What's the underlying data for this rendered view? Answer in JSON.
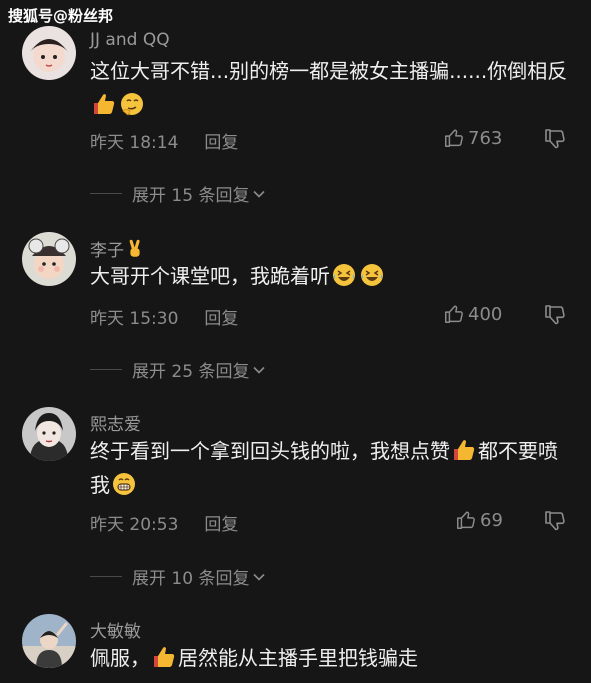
{
  "watermark": "搜狐号@粉丝邦",
  "comments": [
    {
      "username": "JJ  and  QQ",
      "text_parts": [
        "这位大哥不错...别的榜一都是被女主播骗......你倒相反"
      ],
      "emojis": [
        "thumbs-up-emoji",
        "thinking-face-emoji"
      ],
      "time": "昨天 18:14",
      "reply": "回复",
      "likes": "763",
      "expand": "展开 15 条回复"
    },
    {
      "username": "李子",
      "username_emoji": "victory-hand-emoji",
      "text_parts": [
        "大哥开个课堂吧，我跪着听"
      ],
      "emojis": [
        "rolling-laughing-emoji",
        "rolling-laughing-emoji"
      ],
      "time": "昨天 15:30",
      "reply": "回复",
      "likes": "400",
      "expand": "展开 25 条回复"
    },
    {
      "username": "熙志爱",
      "text_parts": [
        "终于看到一个拿到回头钱的啦，我想点赞",
        "都不要喷我"
      ],
      "emojis": [
        "thumbs-up-emoji",
        "grinning-face-emoji"
      ],
      "time": "昨天 20:53",
      "reply": "回复",
      "likes": "69",
      "expand": "展开 10 条回复"
    },
    {
      "username": "大敏敏",
      "text_parts": [
        "佩服，",
        "居然能从主播手里把钱骗走"
      ],
      "emojis": [
        "thumbs-up-emoji"
      ]
    }
  ],
  "colors": {
    "background": "#161616",
    "username": "#9a9a9a",
    "text": "#efefef",
    "meta": "#8c8c8c"
  }
}
